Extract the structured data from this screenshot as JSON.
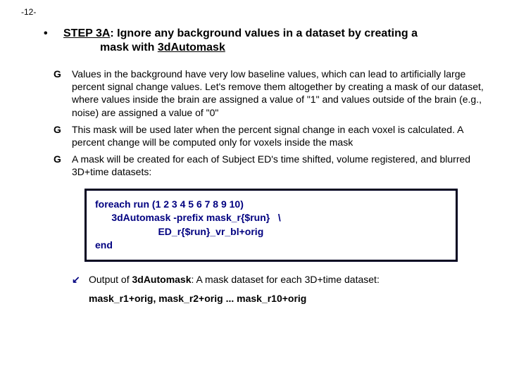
{
  "page_number": "-12-",
  "step": {
    "label": "STEP 3A",
    "line1": ": Ignore any background values in a dataset by creating a",
    "line2": "mask with ",
    "program": "3dAutomask"
  },
  "bullets": [
    "Values in the background have very low baseline values, which can lead to artificially large percent signal change values. Let's remove them altogether by creating a mask of our dataset, where values inside the brain are assigned a value of \"1\" and values outside of the brain (e.g., noise) are assigned a value of \"0\"",
    "This mask will be used later when the percent signal change in each voxel is calculated. A percent change will be computed only for voxels inside the mask",
    "A mask will be created for each of Subject ED's time shifted, volume registered, and blurred 3D+time datasets:"
  ],
  "code": {
    "l1": "foreach run (1 2 3 4 5 6 7 8 9 10)",
    "l2": "      3dAutomask -prefix mask_r{$run}   \\",
    "l3": "                       ED_r{$run}_vr_bl+orig",
    "l4": "end"
  },
  "output": {
    "lead": "Output of ",
    "prog": "3dAutomask",
    "tail": ": A mask dataset for each 3D+time dataset:"
  },
  "mask_line": {
    "m1": "mask_r1+orig,",
    "sep": "   ",
    "m2": "mask_r2+orig ... mask_r10+orig"
  }
}
